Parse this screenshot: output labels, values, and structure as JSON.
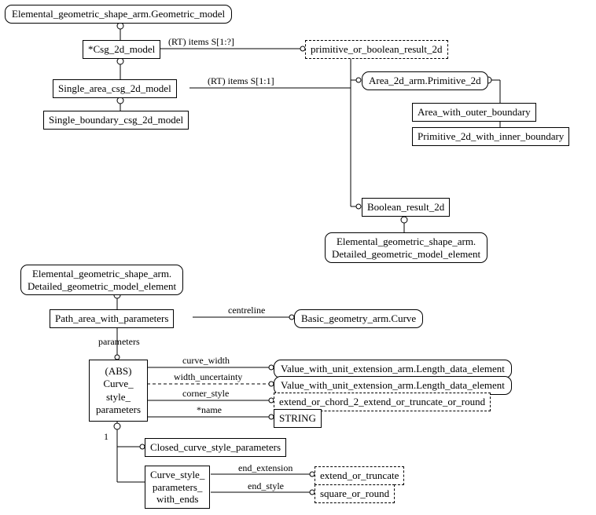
{
  "nodes": {
    "n1": "Elemental_geometric_shape_arm.Geometric_model",
    "n2": "*Csg_2d_model",
    "n3": "Single_area_csg_2d_model",
    "n4": "Single_boundary_csg_2d_model",
    "n5": "primitive_or_boolean_result_2d",
    "n6": "Area_2d_arm.Primitive_2d",
    "n7": "Area_with_outer_boundary",
    "n8": "Primitive_2d_with_inner_boundary",
    "n9": "Boolean_result_2d",
    "n10a": "Elemental_geometric_shape_arm.",
    "n10b": "Detailed_geometric_model_element",
    "n11a": "Elemental_geometric_shape_arm.",
    "n11b": "Detailed_geometric_model_element",
    "n12": "Path_area_with_parameters",
    "n13": "Basic_geometry_arm.Curve",
    "n14a": "(ABS)",
    "n14b": "Curve_",
    "n14c": "style_",
    "n14d": "parameters",
    "n15": "Value_with_unit_extension_arm.Length_data_element",
    "n16": "Value_with_unit_extension_arm.Length_data_element",
    "n17": "extend_or_chord_2_extend_or_truncate_or_round",
    "n18": "STRING",
    "n19": "Closed_curve_style_parameters",
    "n20a": "Curve_style_",
    "n20b": "parameters_",
    "n20c": "with_ends",
    "n21": "extend_or_truncate",
    "n22": "square_or_round"
  },
  "labels": {
    "l1": "(RT) items S[1:?]",
    "l2": "(RT) items S[1:1]",
    "l3": "centreline",
    "l4": "parameters",
    "l5": "curve_width",
    "l6": "width_uncertainty",
    "l7": "corner_style",
    "l8": "*name",
    "l9": "1",
    "l10": "end_extension",
    "l11": "end_style"
  }
}
